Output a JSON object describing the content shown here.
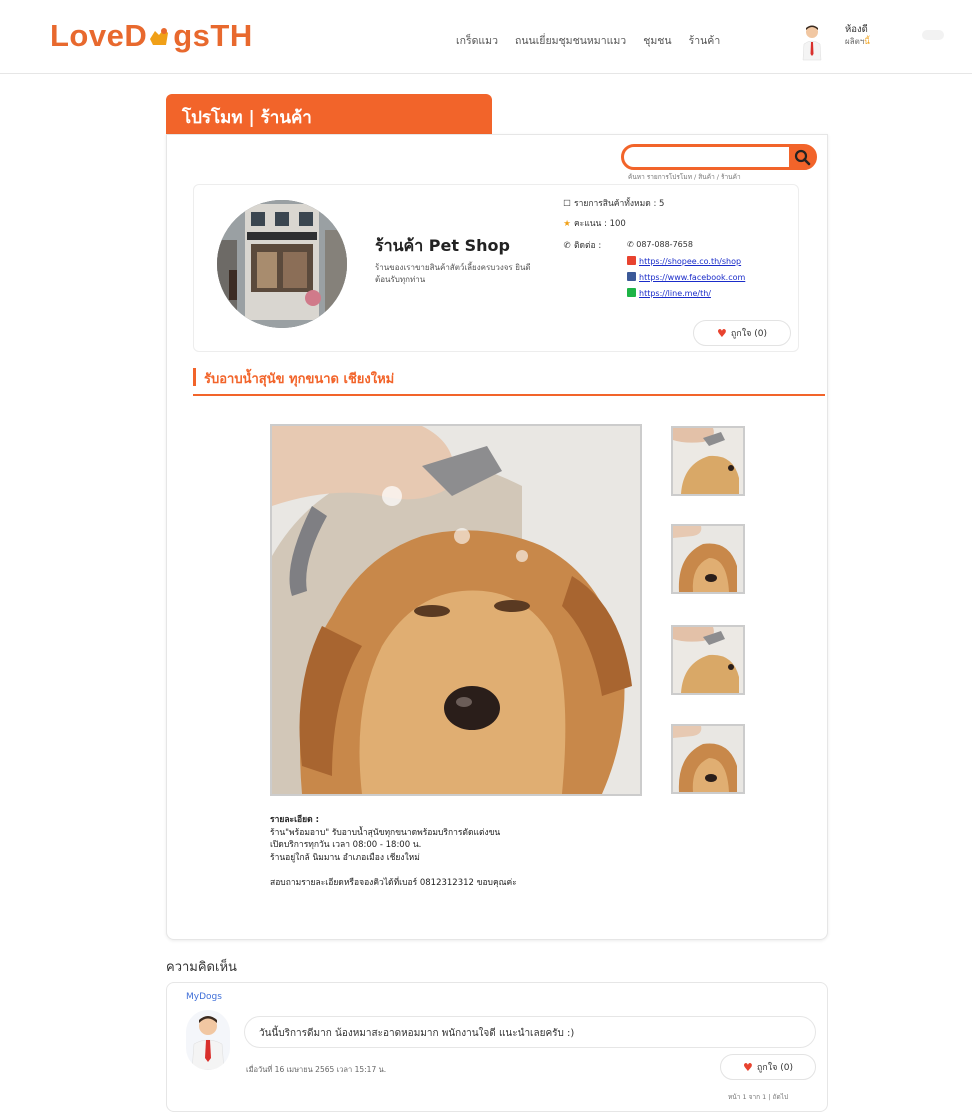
{
  "header": {
    "logo_text_left": "LoveD",
    "logo_text_right": "gsTH",
    "nav": [
      "เกร็ดแมว",
      "ถนนเยี่ยมชุมชนหมาแมว",
      "ชุมชน",
      "ร้านค้า"
    ],
    "user_name": "ห้องดี",
    "user_sub_prefix": "ผลิตฯ",
    "user_sub_accent": "นี้"
  },
  "promo_tab": {
    "label": "โปรโมท | ร้านค้า"
  },
  "search": {
    "placeholder": "",
    "hint": "ค้นหา รายการโปรโมท / สินค้า / ร้านค้า"
  },
  "shop": {
    "name": "ร้านค้า Pet Shop",
    "description": "ร้านของเราขายสินค้าสัตว์เลี้ยงครบวงจร ยินดีต้อนรับทุกท่าน",
    "stats": [
      {
        "icon": "clipboard-icon",
        "label": "รายการสินค้าทั้งหมด : 5"
      },
      {
        "icon": "star-icon",
        "label": "คะแนน : 100"
      },
      {
        "icon": "phone-icon",
        "label": "ติดต่อ :"
      }
    ],
    "phone": "087-088-7658",
    "links": [
      {
        "icon": "shopee-icon",
        "color": "#e8432f",
        "text": "https://shopee.co.th/shop"
      },
      {
        "icon": "facebook-icon",
        "color": "#3b5998",
        "text": "https://www.facebook.com"
      },
      {
        "icon": "line-icon",
        "color": "#1db446",
        "text": "https://line.me/th/"
      }
    ],
    "like_label": "ถูกใจ (0)"
  },
  "promotion": {
    "title": "รับอาบน้ำสุนัข ทุกขนาด เชียงใหม่",
    "detail_heading": "รายละเอียด :",
    "detail_lines": [
      "ร้าน\"พร้อมอาบ\" รับอาบน้ำสุนัขทุกขนาดพร้อมบริการตัดแต่งขน",
      "เปิดบริการทุกวัน เวลา 08:00 - 18:00 น.",
      "ร้านอยู่ใกล้ นิมมาน อำเภอเมือง เชียงใหม่",
      "",
      "สอบถามรายละเอียดหรือจองคิวได้ที่เบอร์ 0812312312 ขอบคุณค่ะ"
    ]
  },
  "comments": {
    "section_title": "ความคิดเห็น",
    "items": [
      {
        "user": "MyDogs",
        "text": "วันนี้บริการดีมาก น้องหมาสะอาดหอมมาก พนักงานใจดี แนะนำเลยครับ :)",
        "date": "เมื่อวันที่ 16 เมษายน 2565 เวลา 15:17 น.",
        "like_label": "ถูกใจ (0)"
      }
    ],
    "footer": "หน้า 1 จาก 1 | ถัดไป"
  },
  "colors": {
    "accent": "#f2642a",
    "link": "#1a2cc9",
    "comment_user": "#3f6fd8"
  }
}
